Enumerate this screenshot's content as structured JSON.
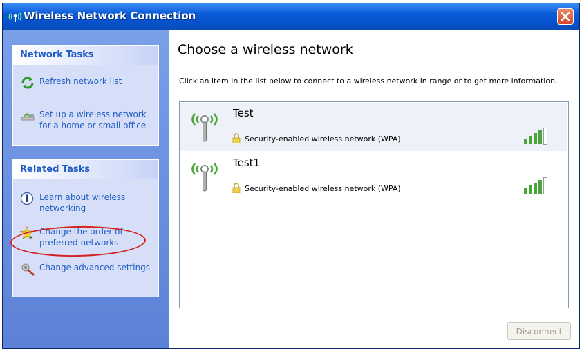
{
  "window": {
    "title": "Wireless Network Connection",
    "title_icon": "wireless-network-icon",
    "close_icon": "close-icon"
  },
  "sidebar": {
    "network_tasks": {
      "header": "Network Tasks",
      "items": [
        {
          "label": "Refresh network list",
          "icon": "refresh-icon"
        },
        {
          "label": "Set up a wireless network for a home or small office",
          "icon": "setup-wireless-icon"
        }
      ]
    },
    "related_tasks": {
      "header": "Related Tasks",
      "items": [
        {
          "label": "Learn about wireless networking",
          "icon": "info-icon"
        },
        {
          "label": "Change the order of preferred networks",
          "icon": "star-icon"
        },
        {
          "label": "Change advanced settings",
          "icon": "settings-icon"
        }
      ]
    }
  },
  "main": {
    "title": "Choose a wireless network",
    "instructions": "Click an item in the list below to connect to a wireless network in range or to get more information.",
    "networks": [
      {
        "name": "Test",
        "status": "Security-enabled wireless network (WPA)",
        "signal": "4/5"
      },
      {
        "name": "Test1",
        "status": "Security-enabled wireless network (WPA)",
        "signal": "4/5"
      }
    ],
    "disconnect_label": "Disconnect"
  },
  "colors": {
    "title_bar": "#0a5ad8",
    "sidebar": "#6a90e0",
    "link": "#215dc6",
    "highlight": "#d42020",
    "selected_row": "#eef1f7"
  }
}
